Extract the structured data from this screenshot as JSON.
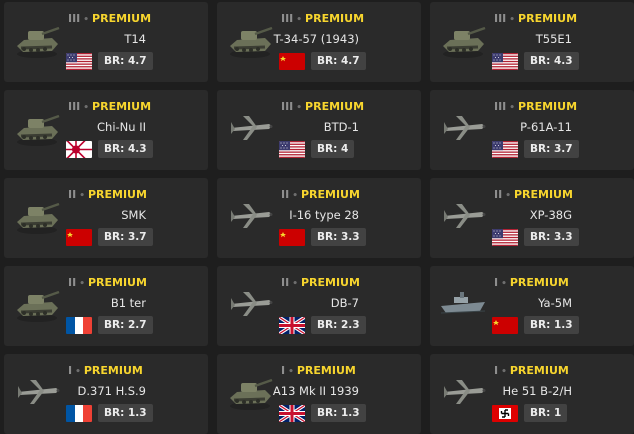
{
  "colors": {
    "premium": "#f7d52e",
    "card_bg": "#2a2a2a",
    "page_bg": "#1e1e1e",
    "br_bg": "#424242"
  },
  "separator": "•",
  "cards": [
    {
      "tier": "III",
      "premium": "PREMIUM",
      "name": "T14",
      "flag": "usa",
      "br": "BR: 4.7",
      "icon": "tank-icon"
    },
    {
      "tier": "III",
      "premium": "PREMIUM",
      "name": "T-34-57 (1943)",
      "flag": "ussr",
      "br": "BR: 4.7",
      "icon": "tank-icon"
    },
    {
      "tier": "III",
      "premium": "PREMIUM",
      "name": "T55E1",
      "flag": "usa",
      "br": "BR: 4.3",
      "icon": "tank-icon"
    },
    {
      "tier": "III",
      "premium": "PREMIUM",
      "name": "Chi-Nu II",
      "flag": "japan",
      "br": "BR: 4.3",
      "icon": "tank-icon"
    },
    {
      "tier": "III",
      "premium": "PREMIUM",
      "name": "BTD-1",
      "flag": "usa",
      "br": "BR: 4",
      "icon": "plane-icon"
    },
    {
      "tier": "III",
      "premium": "PREMIUM",
      "name": "P-61A-11",
      "flag": "usa",
      "br": "BR: 3.7",
      "icon": "plane-icon"
    },
    {
      "tier": "II",
      "premium": "PREMIUM",
      "name": "SMK",
      "flag": "ussr",
      "br": "BR: 3.7",
      "icon": "tank-icon"
    },
    {
      "tier": "II",
      "premium": "PREMIUM",
      "name": "I-16 type 28",
      "flag": "ussr",
      "br": "BR: 3.3",
      "icon": "plane-icon"
    },
    {
      "tier": "II",
      "premium": "PREMIUM",
      "name": "XP-38G",
      "flag": "usa",
      "br": "BR: 3.3",
      "icon": "plane-icon"
    },
    {
      "tier": "II",
      "premium": "PREMIUM",
      "name": "B1 ter",
      "flag": "france",
      "br": "BR: 2.7",
      "icon": "tank-icon"
    },
    {
      "tier": "II",
      "premium": "PREMIUM",
      "name": "DB-7",
      "flag": "uk",
      "br": "BR: 2.3",
      "icon": "plane-icon"
    },
    {
      "tier": "I",
      "premium": "PREMIUM",
      "name": "Ya-5M",
      "flag": "ussr",
      "br": "BR: 1.3",
      "icon": "ship-icon"
    },
    {
      "tier": "I",
      "premium": "PREMIUM",
      "name": "D.371 H.S.9",
      "flag": "france",
      "br": "BR: 1.3",
      "icon": "plane-icon"
    },
    {
      "tier": "I",
      "premium": "PREMIUM",
      "name": "A13 Mk II 1939",
      "flag": "uk",
      "br": "BR: 1.3",
      "icon": "tank-icon"
    },
    {
      "tier": "I",
      "premium": "PREMIUM",
      "name": "He 51 B-2/H",
      "flag": "germany",
      "br": "BR: 1",
      "icon": "plane-icon"
    }
  ]
}
